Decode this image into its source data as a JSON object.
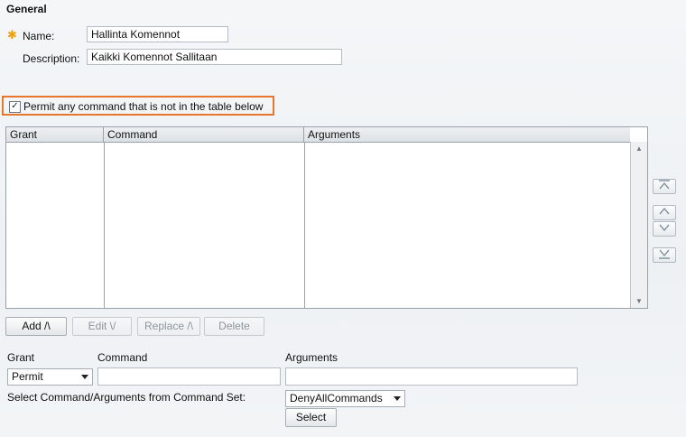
{
  "general": {
    "title": "General",
    "name_label": "Name:",
    "name_value": "Hallinta Komennot",
    "description_label": "Description:",
    "description_value": "Kaikki Komennot Sallitaan"
  },
  "permit": {
    "checked": true,
    "label": "Permit any command that is not in the table below"
  },
  "table": {
    "columns": [
      "Grant",
      "Command",
      "Arguments"
    ],
    "rows": []
  },
  "actions": {
    "add": "Add /\\",
    "edit": "Edit \\/",
    "replace": "Replace /\\",
    "delete": "Delete"
  },
  "form": {
    "grant_label": "Grant",
    "command_label": "Command",
    "arguments_label": "Arguments",
    "grant_value": "Permit",
    "command_value": "",
    "arguments_value": "",
    "command_set_label": "Select Command/Arguments from Command Set:",
    "command_set_value": "DenyAllCommands",
    "select_button": "Select"
  },
  "colors": {
    "highlight_border": "#e8772e",
    "required_icon": "#f0a000"
  }
}
